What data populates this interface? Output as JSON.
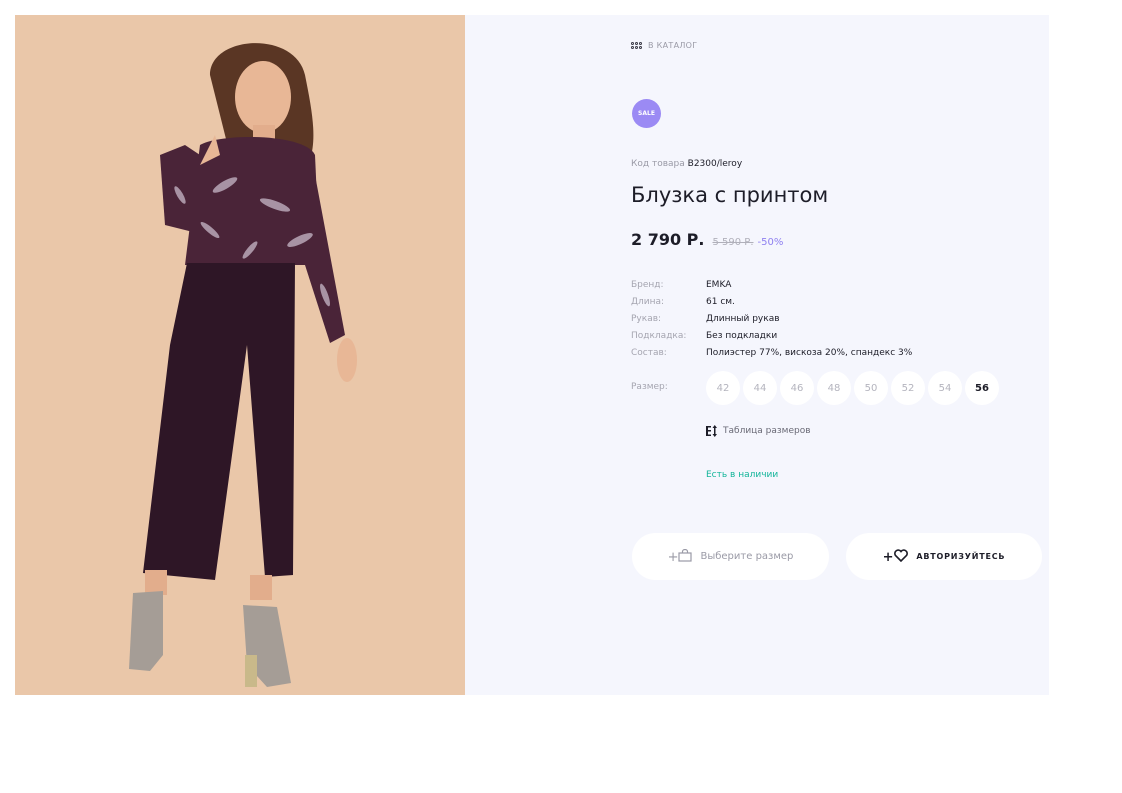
{
  "catalog_link": "В КАТАЛОГ",
  "badge": "SALE",
  "product": {
    "code_label": "Код товара",
    "code": "B2300/leroy",
    "title": "Блузка с принтом",
    "price": "2 790 Р.",
    "old_price": "5 590 Р.",
    "discount": "-50%"
  },
  "specs": [
    {
      "label": "Бренд:",
      "value": "EMKA"
    },
    {
      "label": "Длина:",
      "value": "61 см."
    },
    {
      "label": "Рукав:",
      "value": "Длинный рукав"
    },
    {
      "label": "Подкладка:",
      "value": "Без подкладки"
    },
    {
      "label": "Состав:",
      "value": "Полиэстер 77%, вискоза 20%, спандекс 3%"
    }
  ],
  "size_label": "Размер:",
  "sizes": [
    "42",
    "44",
    "46",
    "48",
    "50",
    "52",
    "54",
    "56"
  ],
  "selected_size": "56",
  "size_table_link": "Таблица размеров",
  "availability": "Есть в наличии",
  "buttons": {
    "cart": "Выберите размер",
    "wishlist": "АВТОРИЗУЙТЕСЬ"
  },
  "colors": {
    "accent": "#9b8af4",
    "in_stock": "#14b59a",
    "panel_bg": "#f5f6fd",
    "photo_bg": "#eac7a9"
  },
  "icons": [
    "catalog-grid-icon",
    "size-table-icon",
    "add-to-cart-icon",
    "wishlist-heart-icon"
  ]
}
